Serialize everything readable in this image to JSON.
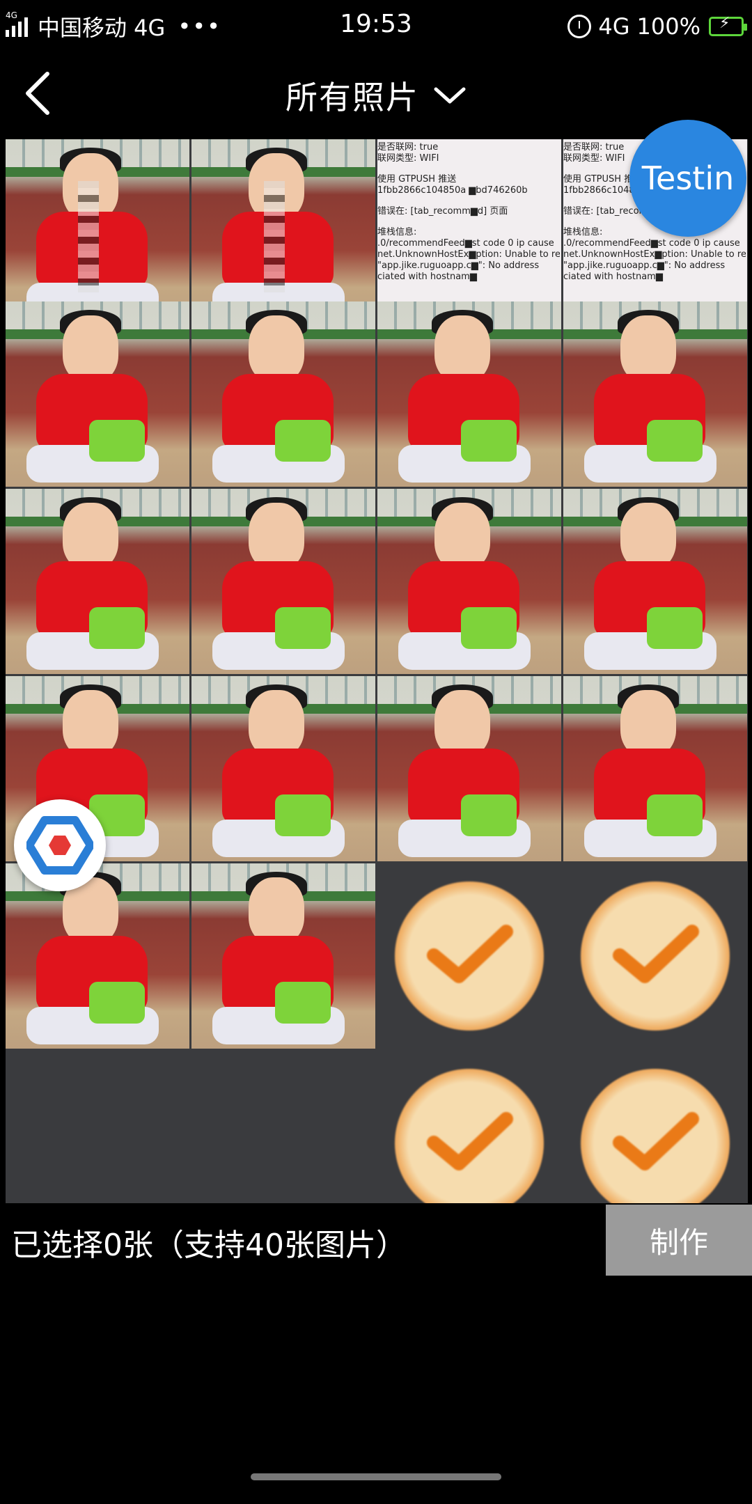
{
  "status_bar": {
    "network_small": "4G",
    "carrier": "中国移动 4G",
    "more": "•••",
    "time": "19:53",
    "net_type": "4G",
    "battery": "100%",
    "icons": [
      "signal-icon",
      "alarm-icon",
      "battery-charging-icon"
    ]
  },
  "header": {
    "back_icon": "back-chevron-icon",
    "title": "所有照片",
    "dropdown_icon": "chevron-down-icon"
  },
  "grid": {
    "columns": 4,
    "screenshot_text": {
      "line1": "是否联网: true",
      "line2": "联网类型: WIFI",
      "line3": "使用 GTPUSH 推送",
      "line4": "1fbb2866c104850a ▆bd746260b",
      "line5": "错误在: [tab_recomm▆d] 页面",
      "line6": "堆栈信息:",
      "line7": ".0/recommendFeed▆st code 0 ip cause",
      "line8": "net.UnknownHostEx▆ption: Unable to reso",
      "line9": "\"app.jike.ruguoapp.c▆\": No address",
      "line10": "ciated with hostnam▆"
    },
    "placeholder_color": "#ea7a17"
  },
  "overlays": {
    "testin_label": "Testin",
    "float_icon": "hexagon-logo-icon"
  },
  "footer": {
    "selected_text": "已选择0张（支持40张图片）",
    "make_button": "制作"
  },
  "colors": {
    "background": "#000000",
    "grid_bg": "#3a3b3e",
    "testin_blue": "#2a86e0",
    "make_button_bg": "#9b9b9b",
    "battery_green": "#5dd63b"
  }
}
